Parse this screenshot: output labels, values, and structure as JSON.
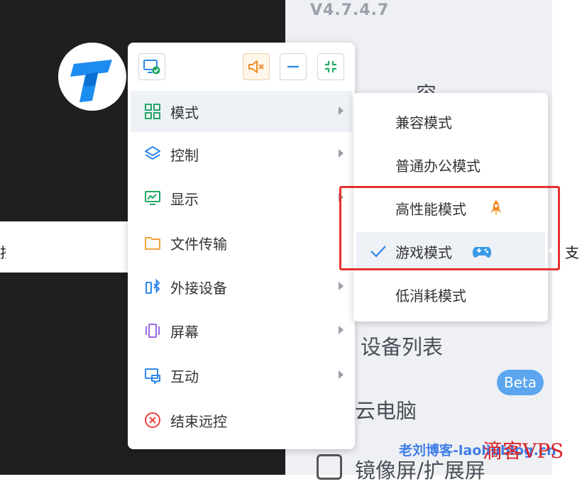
{
  "background": {
    "version": "V4.7.4.7",
    "compat_fragment": "容",
    "device_list": "设备列表",
    "cloud_pc": "云电脑",
    "beta_badge": "Beta",
    "mirror": "镜像屏/扩展屏",
    "right_edge_char": "支",
    "left_edge_char": "按"
  },
  "toolbar": {
    "display_icon": "monitor-check-icon",
    "mute_icon": "speaker-mute-icon",
    "minimize_icon": "minimize-icon",
    "shrink_icon": "shrink-icon"
  },
  "menu": {
    "items": [
      {
        "label": "模式",
        "icon": "grid-icon",
        "has_submenu": true,
        "active": true
      },
      {
        "label": "控制",
        "icon": "layers-icon",
        "has_submenu": true
      },
      {
        "label": "显示",
        "icon": "chart-monitor-icon",
        "has_submenu": true
      },
      {
        "label": "文件传输",
        "icon": "folder-icon",
        "has_submenu": false
      },
      {
        "label": "外接设备",
        "icon": "bluetooth-device-icon",
        "has_submenu": true
      },
      {
        "label": "屏幕",
        "icon": "screen-icon",
        "has_submenu": true
      },
      {
        "label": "互动",
        "icon": "chat-screen-icon",
        "has_submenu": true
      },
      {
        "label": "结束远控",
        "icon": "close-circle-icon",
        "has_submenu": false
      }
    ]
  },
  "submenu": {
    "items": [
      {
        "label": "兼容模式"
      },
      {
        "label": "普通办公模式"
      },
      {
        "label": "高性能模式",
        "badge": "rocket-icon"
      },
      {
        "label": "游戏模式",
        "badge": "gamepad-icon",
        "checked": true
      },
      {
        "label": "低消耗模式"
      }
    ]
  },
  "watermark": {
    "text": "老刘博客-laoliublog.cn",
    "overlay": "滴客VPS"
  },
  "colors": {
    "accent_green": "#23a866",
    "accent_blue": "#2f88ea",
    "highlight_red": "#e5302f",
    "mute_orange": "#f08a24"
  }
}
